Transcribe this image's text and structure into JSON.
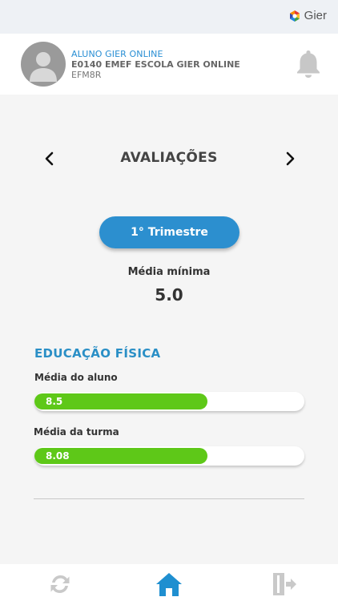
{
  "brand": {
    "name": "Gier"
  },
  "profile": {
    "name": "ALUNO GIER ONLINE",
    "school": "E0140 EMEF ESCOLA GIER ONLINE",
    "class": "EFM8R"
  },
  "header": {
    "title": "AVALIAÇÕES"
  },
  "period": {
    "label": "1° Trimestre"
  },
  "minimum": {
    "label": "Média mínima",
    "value": "5.0"
  },
  "subjects": [
    {
      "name": "EDUCAÇÃO FÍSICA",
      "student_label": "Média do aluno",
      "student_value": "8.5",
      "student_fraction": 0.64,
      "class_label": "Média da turma",
      "class_value": "8.08",
      "class_fraction": 0.64
    }
  ],
  "colors": {
    "accent": "#2c8fcf",
    "bar_fill": "#5ec818",
    "subject_title": "#2a8fc6"
  },
  "icons": {
    "notifications": "bell-icon",
    "prev": "chevron-left-icon",
    "next": "chevron-right-icon",
    "sync": "sync-icon",
    "home": "home-icon",
    "logout": "logout-icon"
  }
}
